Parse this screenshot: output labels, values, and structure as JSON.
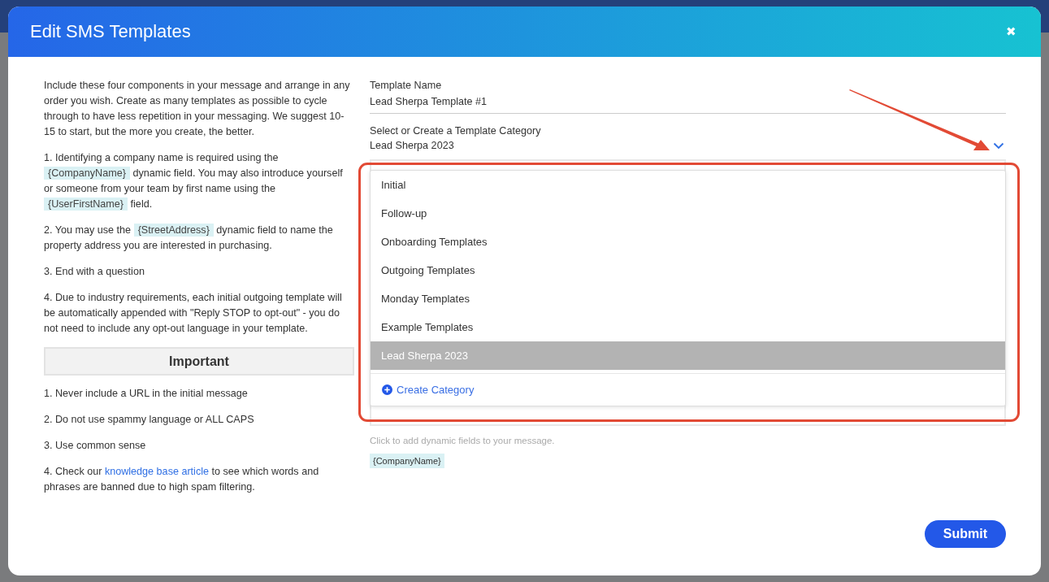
{
  "modal": {
    "title": "Edit SMS Templates",
    "close": "✖"
  },
  "instructions": [
    [
      {
        "kind": "text",
        "text": "Include these four components in your message and arrange in any order you wish. Create as many templates as possible to cycle through to have less repetition in your messaging. We suggest 10-15 to start, but the more you create, the better."
      }
    ],
    [
      {
        "kind": "text",
        "text": "1. Identifying a company name is required using the "
      },
      {
        "kind": "tag",
        "text": "{CompanyName}"
      },
      {
        "kind": "text",
        "text": " dynamic field. You may also introduce yourself or someone from your team by first name using the "
      },
      {
        "kind": "tag",
        "text": "{UserFirstName}"
      },
      {
        "kind": "text",
        "text": " field."
      }
    ],
    [
      {
        "kind": "text",
        "text": "2. You may use the "
      },
      {
        "kind": "tag",
        "text": "{StreetAddress}"
      },
      {
        "kind": "text",
        "text": " dynamic field to name the property address you are interested in purchasing."
      }
    ],
    [
      {
        "kind": "text",
        "text": "3. End with a question"
      }
    ],
    [
      {
        "kind": "text",
        "text": "4. Due to industry requirements, each initial outgoing template will be automatically appended with \"Reply STOP to opt-out\" - you do not need to include any opt-out language in your template."
      }
    ]
  ],
  "important": {
    "heading": "Important",
    "items": [
      [
        {
          "kind": "text",
          "text": "1. Never include a URL in the initial message"
        }
      ],
      [
        {
          "kind": "text",
          "text": "2. Do not use spammy language or ALL CAPS"
        }
      ],
      [
        {
          "kind": "text",
          "text": "3. Use common sense"
        }
      ],
      [
        {
          "kind": "text",
          "text": "4. Check our "
        },
        {
          "kind": "link",
          "text": "knowledge base article"
        },
        {
          "kind": "text",
          "text": " to see which words and phrases are banned due to high spam filtering."
        }
      ]
    ]
  },
  "form": {
    "name_label": "Template Name",
    "name_value": "Lead Sherpa Template #1",
    "category_label": "Select or Create a Template Category",
    "category_value": "Lead Sherpa 2023",
    "dropdown": {
      "expanded": true,
      "options": [
        {
          "label": "Initial",
          "selected": false
        },
        {
          "label": "Follow-up",
          "selected": false
        },
        {
          "label": "Onboarding Templates",
          "selected": false
        },
        {
          "label": "Outgoing Templates",
          "selected": false
        },
        {
          "label": "Monday Templates",
          "selected": false
        },
        {
          "label": "Example Templates",
          "selected": false
        },
        {
          "label": "Lead Sherpa 2023",
          "selected": true
        }
      ],
      "create_label": "Create Category"
    },
    "hint": "Click to add dynamic fields to your message.",
    "tags": [
      "{CompanyName}"
    ],
    "submit": "Submit"
  }
}
